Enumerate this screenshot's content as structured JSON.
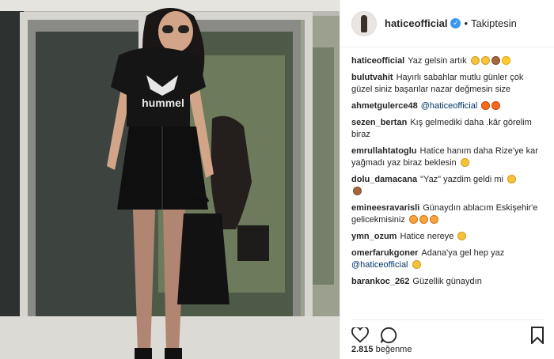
{
  "post": {
    "username": "haticeofficial",
    "follow_status": "Takiptesin",
    "likes_count": "2.815",
    "likes_label": "beğenme"
  },
  "comments": [
    {
      "user": "haticeofficial",
      "text": "Yaz gelsin artık",
      "emojis": [
        "grin",
        "smile",
        "monkey",
        "sun"
      ]
    },
    {
      "user": "bulutvahit",
      "text": "Hayırlı sabahlar mutlu günler çok güzel siniz başarılar nazar değmesin size",
      "emojis": []
    },
    {
      "user": "ahmetgulerce48",
      "mention": "@haticeofficial",
      "text": "",
      "emojis": [
        "fire",
        "fire"
      ]
    },
    {
      "user": "sezen_bertan",
      "text": "Kış gelmediki daha .kâr görelim biraz",
      "emojis": []
    },
    {
      "user": "emrullahtatoglu",
      "text": "Hatice hanım daha Rize'ye kar yağmadı yaz biraz beklesin",
      "emojis": [
        "grin"
      ]
    },
    {
      "user": "dolu_damacana",
      "text": "\"Yaz\" yazdim geldi mi",
      "emojis": [
        "grin",
        "monkey"
      ]
    },
    {
      "user": "emineesravarisli",
      "text": "Günaydın ablacım Eskişehir'e gelicekmisiniz",
      "emojis": [
        "heart",
        "heart",
        "heart"
      ]
    },
    {
      "user": "ymn_ozum",
      "text": "Hatice nereye",
      "emojis": [
        "smile"
      ]
    },
    {
      "user": "omerfarukgoner",
      "text": "Adana'ya gel hep yaz",
      "mention2": "@haticeofficial",
      "emojis": [
        "grin"
      ]
    },
    {
      "user": "barankoc_262",
      "text": "Güzellik günaydın",
      "emojis": []
    }
  ],
  "photo": {
    "shirt_text": "hummel"
  },
  "icons": {
    "like": "heart-outline-icon",
    "comment": "speech-bubble-icon",
    "save": "bookmark-icon",
    "verified": "verified-badge-icon"
  }
}
